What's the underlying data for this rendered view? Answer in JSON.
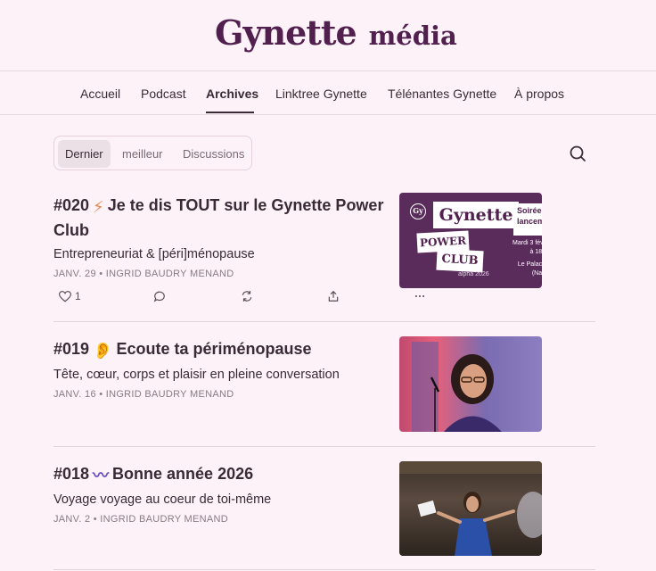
{
  "site": {
    "brand": "Gynette",
    "media": "média"
  },
  "nav": {
    "items": [
      {
        "label": "Accueil"
      },
      {
        "label": "Podcast"
      },
      {
        "label": "Archives",
        "active": true
      },
      {
        "label": "Linktree Gynette"
      },
      {
        "label": "Télénantes Gynette"
      },
      {
        "label": "À propos"
      }
    ]
  },
  "tabs": [
    {
      "label": "Dernier",
      "active": true
    },
    {
      "label": "meilleur"
    },
    {
      "label": "Discussions"
    }
  ],
  "posts": [
    {
      "title_number": "#020",
      "title_emoji": "⚡",
      "title_text": "Je te dis TOUT sur le Gynette Power Club",
      "subtitle": "Entrepreneuriat & [péri]ménopause",
      "meta": "JANV. 29 • INGRID BAUDRY MENAND",
      "likes": "1",
      "thumb": {
        "logo_badge": "Gy",
        "brand": "Gynette",
        "line1": "POWER",
        "line2": "CLUB",
        "edition": "alpha 2026",
        "event_title": "Soirée lancem",
        "event_date": "Mardi 3 févr à 18h",
        "event_place": "Le Palace (Nan"
      }
    },
    {
      "title_number": "#019",
      "title_emoji": "👂",
      "title_text": "Ecoute ta périménopause",
      "subtitle": "Tête, cœur, corps et plaisir en pleine conversation",
      "meta": "JANV. 16 • INGRID BAUDRY MENAND"
    },
    {
      "title_number": "#018",
      "title_emoji": "〰",
      "title_text": "Bonne année 2026",
      "subtitle": "Voyage voyage au coeur de toi-même",
      "meta": "JANV. 2 • INGRID BAUDRY MENAND"
    }
  ],
  "icons": {
    "search": "search-icon",
    "like": "heart-icon",
    "comment": "comment-icon",
    "restack": "restack-icon",
    "share": "share-icon",
    "more": "more-icon"
  },
  "colors": {
    "background": "#fcf2f8",
    "brand": "#52204f",
    "text": "#3a2a36",
    "muted": "#8a7a84"
  }
}
